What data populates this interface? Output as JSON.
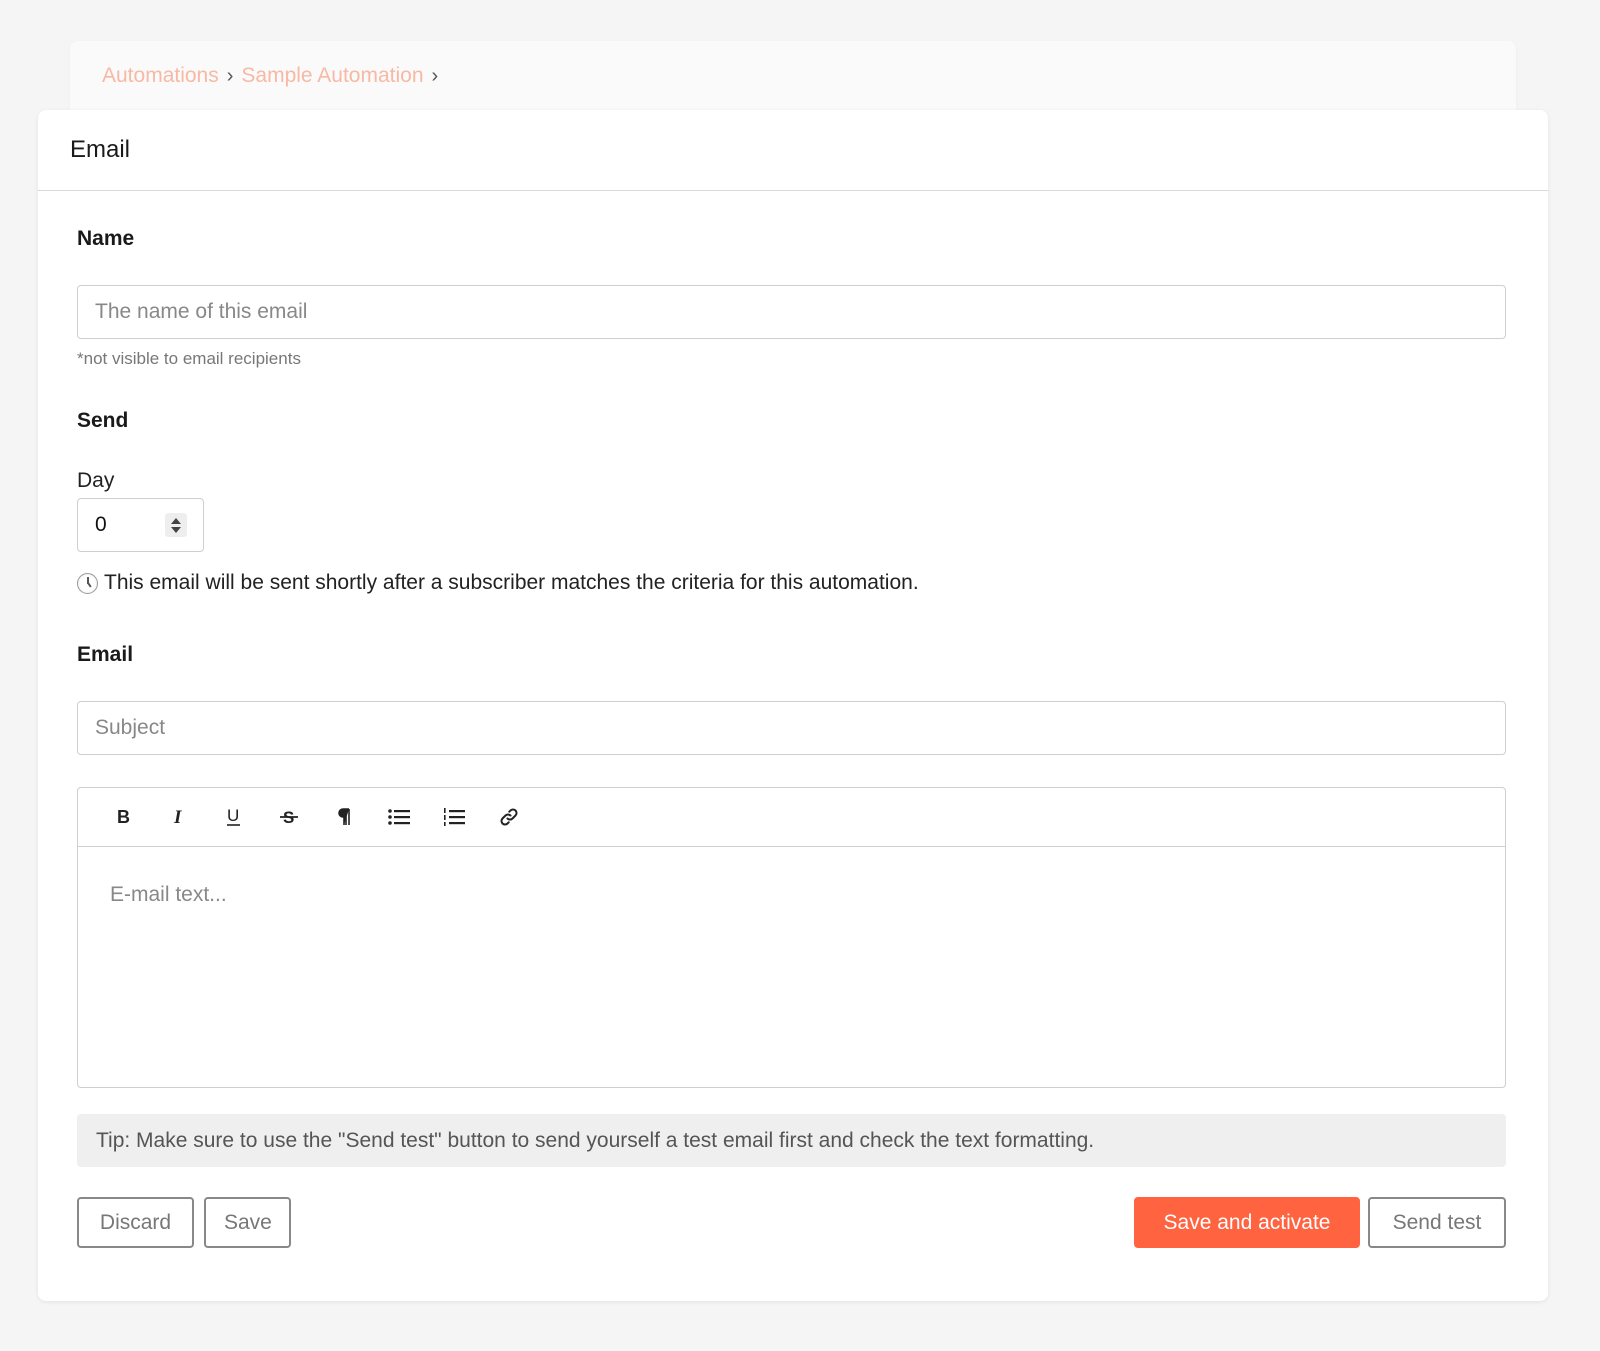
{
  "breadcrumb": {
    "items": [
      "Automations",
      "Sample Automation"
    ],
    "separator": "›"
  },
  "card": {
    "title": "Email"
  },
  "name_section": {
    "label": "Name",
    "placeholder": "The name of this email",
    "value": "",
    "hint": "*not visible to email recipients"
  },
  "send_section": {
    "label": "Send",
    "day_label": "Day",
    "day_value": "0",
    "info": "This email will be sent shortly after a subscriber matches the criteria for this automation."
  },
  "email_section": {
    "label": "Email",
    "subject_placeholder": "Subject",
    "body_placeholder": "E-mail text...",
    "toolbar": [
      "bold",
      "italic",
      "underline",
      "strikethrough",
      "paragraph",
      "bullet-list",
      "ordered-list",
      "link"
    ]
  },
  "tip": "Tip: Make sure to use the \"Send test\" button to send yourself a test email first and check the text formatting.",
  "buttons": {
    "discard": "Discard",
    "save": "Save",
    "save_activate": "Save and activate",
    "send_test": "Send test"
  },
  "colors": {
    "accent": "#ff6340",
    "breadcrumb_link": "#f8b9a4"
  }
}
